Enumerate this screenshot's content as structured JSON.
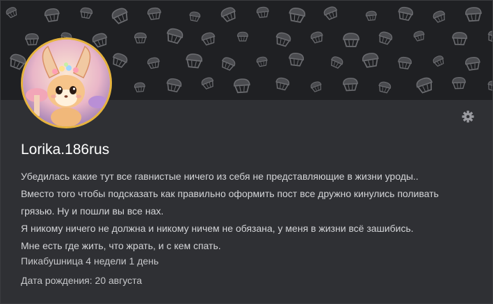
{
  "profile": {
    "username": "Lorika.186rus",
    "bio_lines": [
      "Убедилась какие тут все гавнистые ничего из себя не представляющие в жизни уроды..",
      "Вместо того чтобы подсказать как правильно оформить пост все дружно кинулись поливать",
      "грязью. Ну и пошли вы все нах.",
      "Я никому ничего не должна и никому ничем не обязана, у меня в жизни всё зашибись.",
      "Мне есть где жить, что жрать, и с кем спать."
    ],
    "membership": "Пикабушница 4 недели 1 день",
    "birthday": "Дата рождения: 20 августа"
  },
  "icons": {
    "settings": "gear-icon",
    "cover_pattern": "cupcake-icon"
  },
  "colors": {
    "background": "#2f3034",
    "cover": "#1f2023",
    "avatar_border": "#e6b33d",
    "text_primary": "#ffffff",
    "text_secondary": "#d4d5d8"
  }
}
